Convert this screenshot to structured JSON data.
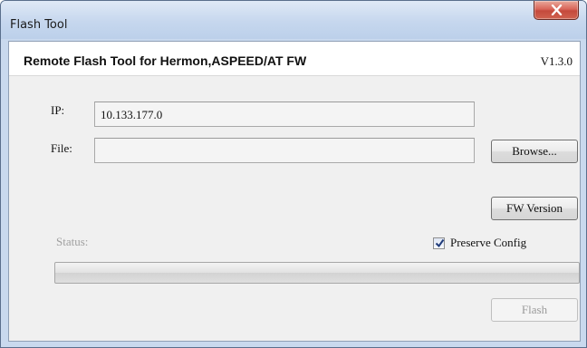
{
  "window": {
    "title": "Flash Tool",
    "close_icon": "close-x-icon"
  },
  "header": {
    "tool_title": "Remote Flash Tool for Hermon,ASPEED/AT FW",
    "version": "V1.3.0"
  },
  "form": {
    "ip_label": "IP:",
    "ip_value": "10.133.177.0",
    "file_label": "File:",
    "file_value": "",
    "browse_label": "Browse...",
    "fw_version_label": "FW Version",
    "status_label": "Status:",
    "preserve_config_label": "Preserve Config",
    "preserve_config_checked": true,
    "progress_fraction": 0,
    "flash_label": "Flash"
  },
  "colors": {
    "titlebar": "#c6d7ee",
    "client_bg": "#f0f0f0",
    "close_button": "#c44a3c"
  }
}
